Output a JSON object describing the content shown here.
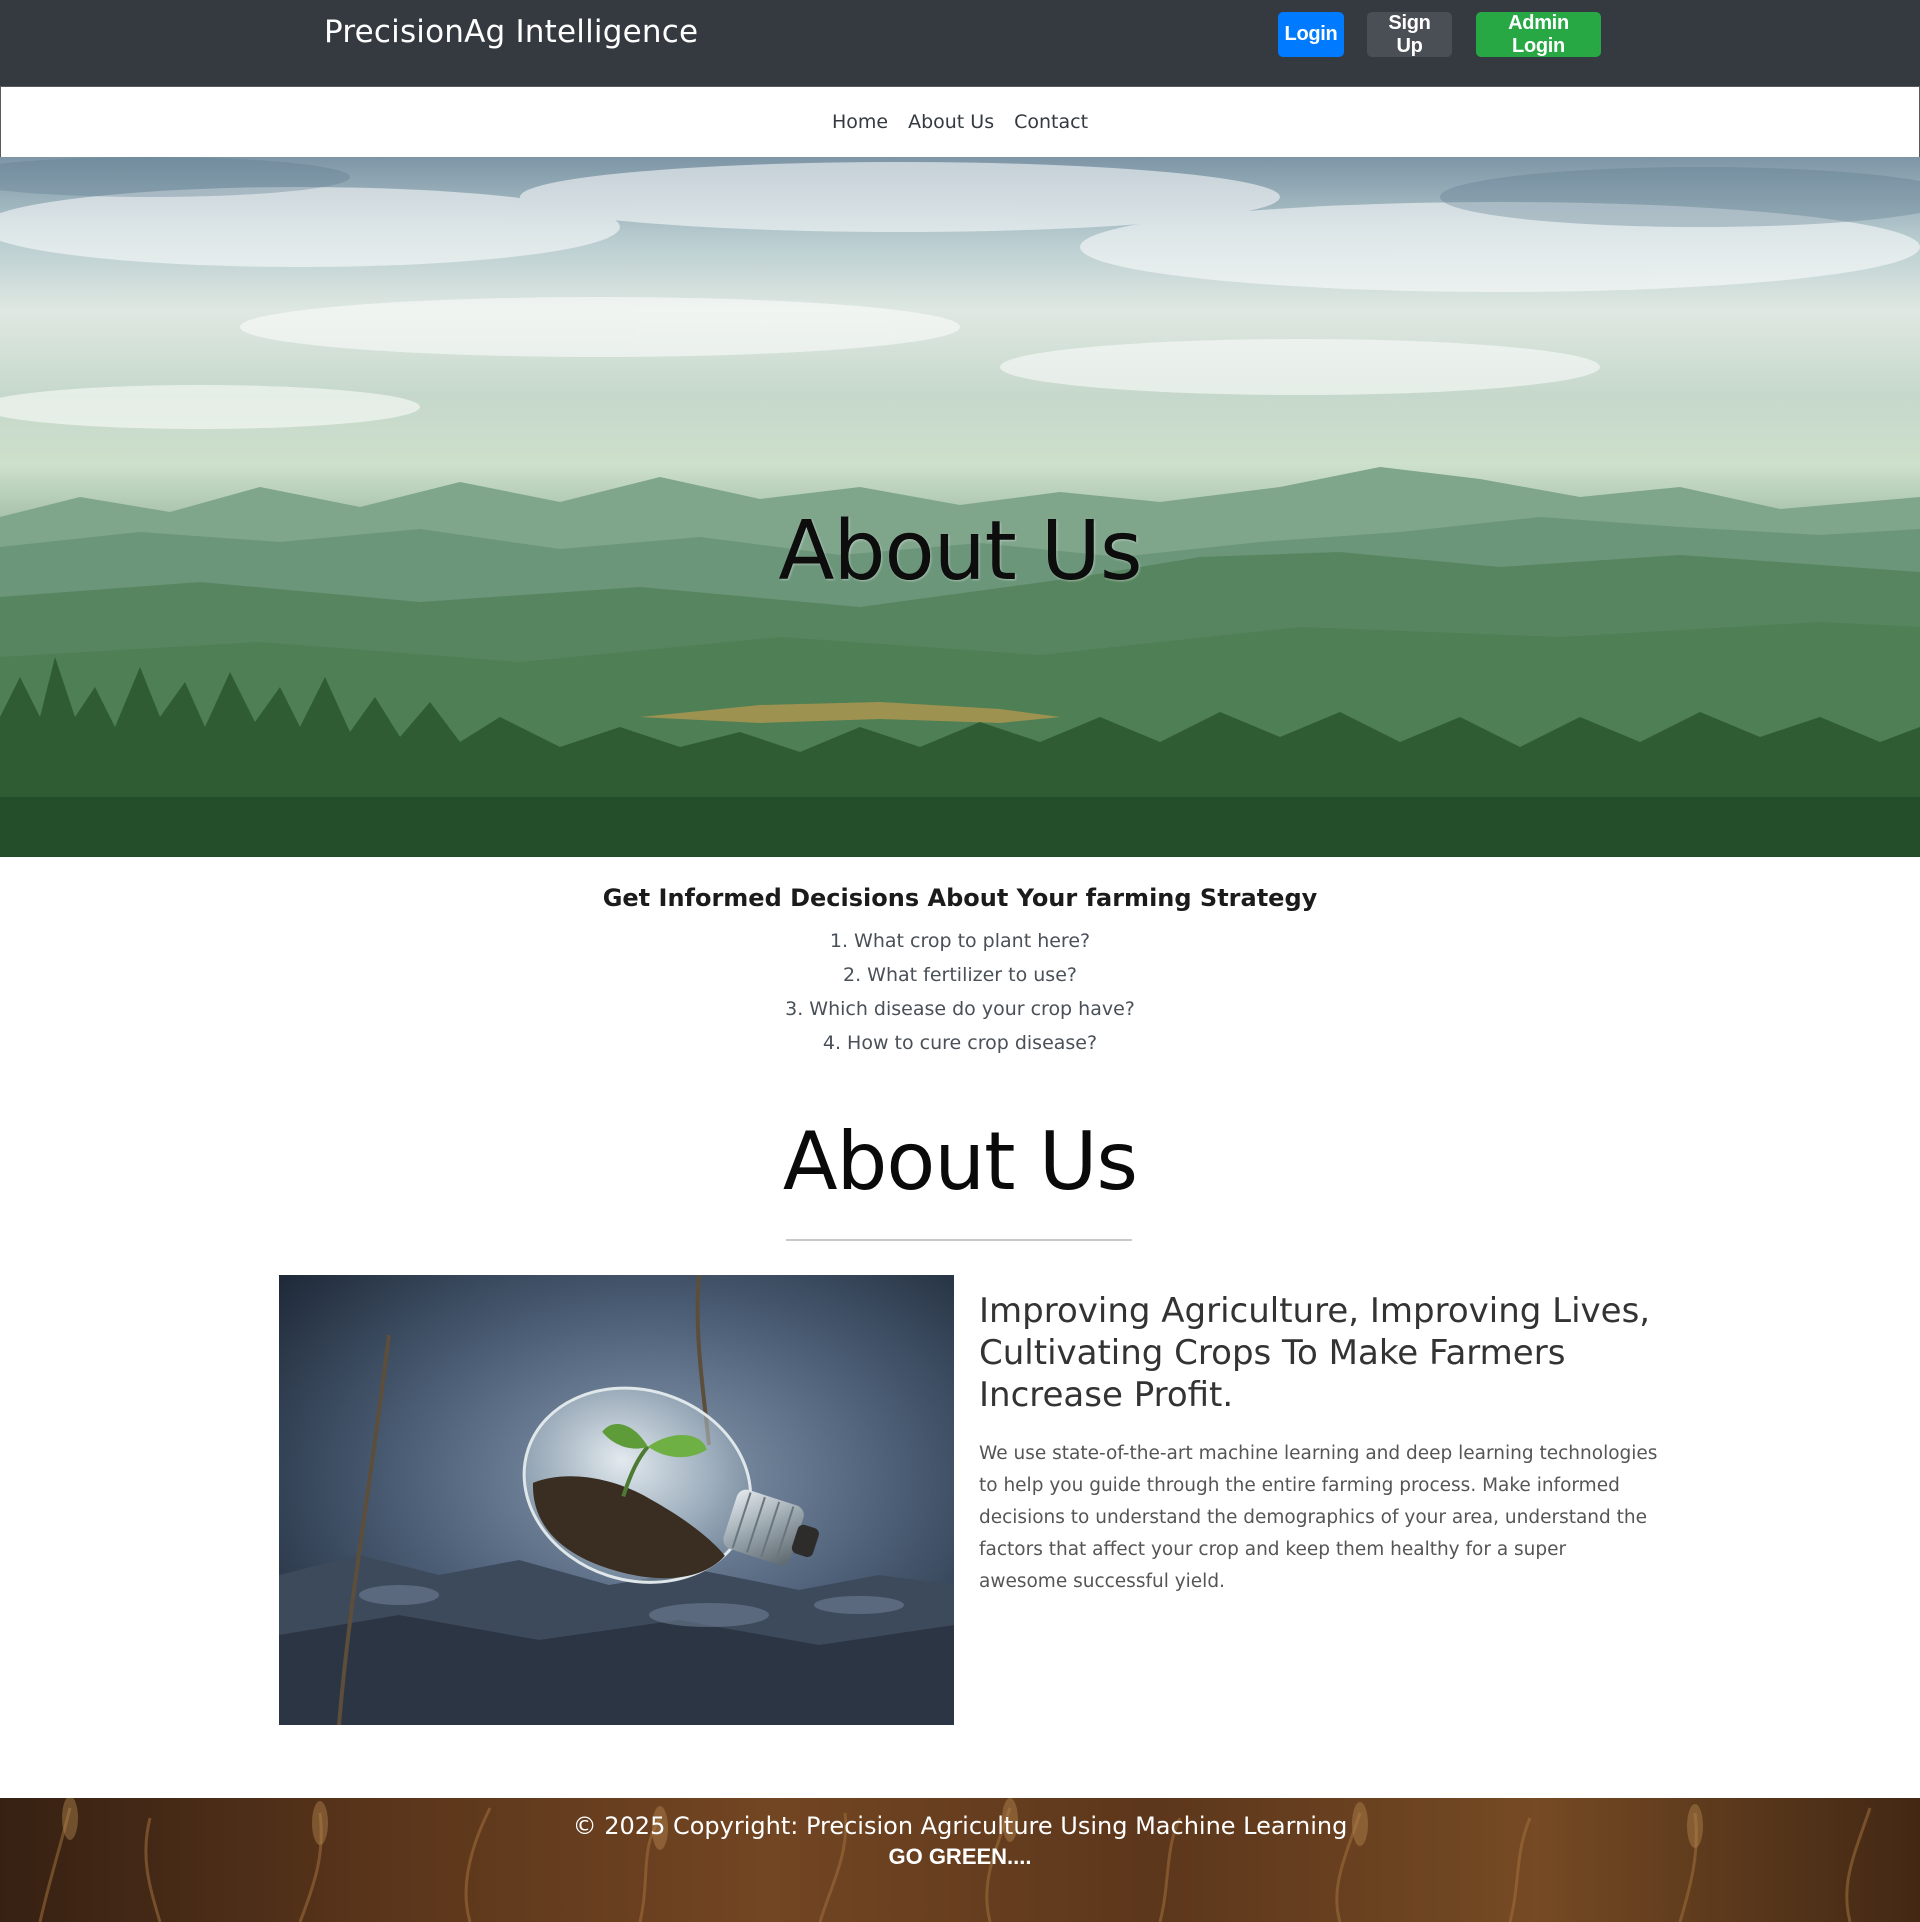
{
  "header": {
    "brand": "PrecisionAg Intelligence",
    "buttons": {
      "login": "Login",
      "signup": "Sign Up",
      "admin_login": "Admin Login"
    }
  },
  "nav": {
    "items": [
      "Home",
      "About Us",
      "Contact"
    ]
  },
  "hero": {
    "title": "About Us"
  },
  "info": {
    "heading": "Get Informed Decisions About Your farming Strategy",
    "items": [
      "1. What crop to plant here?",
      "2. What fertilizer to use?",
      "3. Which disease do your crop have?",
      "4. How to cure crop disease?"
    ]
  },
  "about": {
    "title": "About Us",
    "headline": "Improving Agriculture, Improving Lives, Cultivating Crops To Make Farmers Increase Profit.",
    "body": "We use state-of-the-art machine learning and deep learning technologies to help you guide through the entire farming process. Make informed decisions to understand the demographics of your area, understand the factors that affect your crop and keep them healthy for a super awesome successful yield."
  },
  "footer": {
    "copyright": "© 2025 Copyright: Precision Agriculture Using Machine Learning",
    "tagline": "GO GREEN...."
  },
  "colors": {
    "topbar": "#343a40",
    "login": "#007bff",
    "signup": "#494f55",
    "admin_login": "#28a745"
  }
}
